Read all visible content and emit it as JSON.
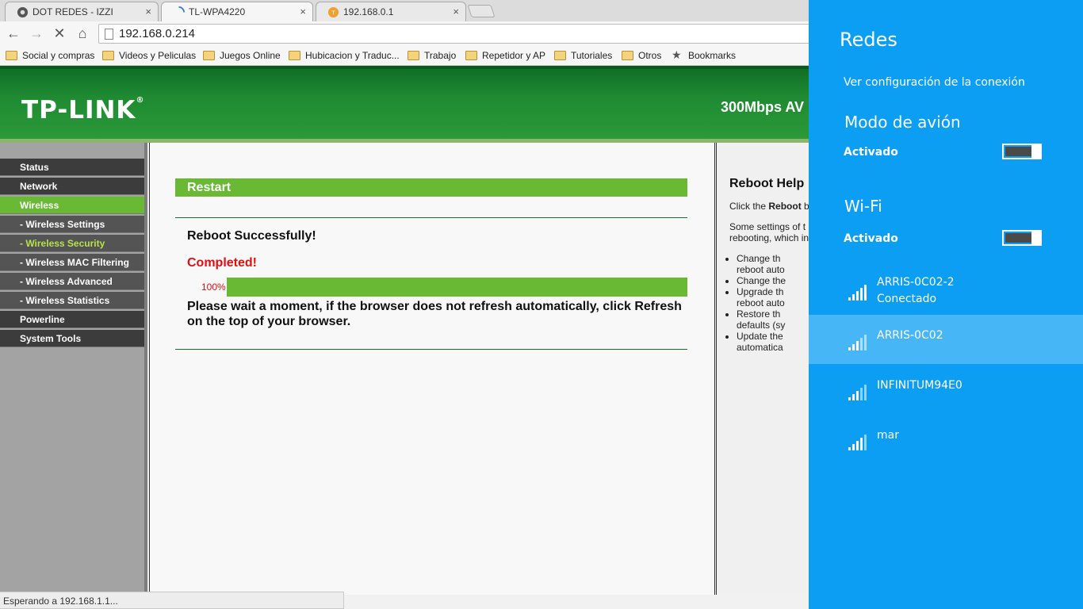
{
  "browser": {
    "tabs": [
      {
        "title": "DOT REDES - IZZI",
        "close": "×"
      },
      {
        "title": "TL-WPA4220",
        "close": "×"
      },
      {
        "title": "192.168.0.1",
        "close": "×"
      }
    ],
    "url": "192.168.0.214",
    "bookmarks": [
      "Social y compras",
      "Videos y Peliculas",
      "Juegos Online",
      "Hubicacion y Traduc...",
      "Trabajo",
      "Repetidor y AP",
      "Tutoriales",
      "Otros",
      "Bookmarks"
    ],
    "status_text": "Esperando a 192.168.1.1..."
  },
  "tplink": {
    "logo": "TP-LINK",
    "logo_mark": "®",
    "model": "300Mbps AV",
    "menu": [
      {
        "label": "Status",
        "sub": false,
        "active": false
      },
      {
        "label": "Network",
        "sub": false,
        "active": false
      },
      {
        "label": "Wireless",
        "sub": false,
        "active": true
      },
      {
        "label": "- Wireless Settings",
        "sub": true,
        "active": false
      },
      {
        "label": "- Wireless Security",
        "sub": true,
        "active": true
      },
      {
        "label": "- Wireless MAC Filtering",
        "sub": true,
        "active": false
      },
      {
        "label": "- Wireless Advanced",
        "sub": true,
        "active": false
      },
      {
        "label": "- Wireless Statistics",
        "sub": true,
        "active": false
      },
      {
        "label": "Powerline",
        "sub": false,
        "active": false
      },
      {
        "label": "System Tools",
        "sub": false,
        "active": false
      }
    ],
    "main": {
      "section_title": "Restart",
      "status": "Reboot Successfully!",
      "completed": "Completed!",
      "progress_label": "100%",
      "progress": 1.0,
      "wait_message": "Please wait a moment, if the browser does not refresh automatically, click Refresh on the top of your browser."
    },
    "help": {
      "title": "Reboot Help",
      "intro_prefix": "Click the ",
      "intro_bold": "Reboot",
      "intro_suffix": " b",
      "para2_line1": "Some settings of t",
      "para2_line2": "rebooting, which in",
      "items": [
        [
          "Change th",
          "reboot auto"
        ],
        [
          "Change the"
        ],
        [
          "Upgrade th",
          "reboot auto"
        ],
        [
          "Restore th",
          "defaults (sy"
        ],
        [
          "Update the",
          "automatica"
        ]
      ]
    }
  },
  "charm": {
    "title": "Redes",
    "connection_settings": "Ver configuración de la conexión",
    "airplane_mode": {
      "title": "Modo de avión",
      "state": "Activado"
    },
    "wifi": {
      "title": "Wi-Fi",
      "state": "Activado"
    },
    "networks": [
      {
        "name": "ARRIS-0C02-2",
        "status": "Conectado"
      },
      {
        "name": "ARRIS-0C02",
        "status": ""
      },
      {
        "name": "INFINITUM94E0",
        "status": ""
      },
      {
        "name": "mar",
        "status": ""
      }
    ]
  },
  "colors": {
    "tplink_green": "#6ab934",
    "charm_blue": "#0b9ef2",
    "error_red": "#e01010"
  }
}
